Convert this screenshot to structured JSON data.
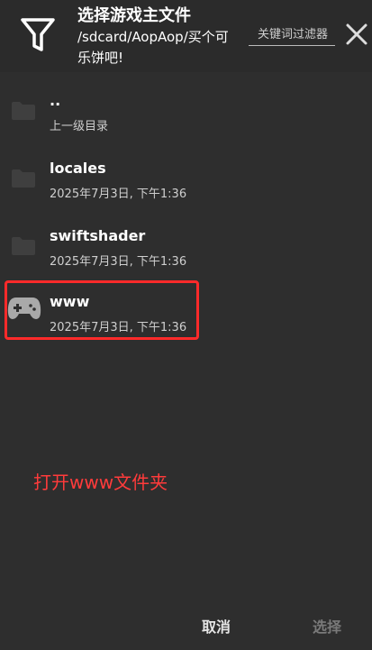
{
  "header": {
    "title": "选择游戏主文件",
    "path": "/sdcard/AopAop/买个可乐饼吧!",
    "filter_placeholder": "关键词过滤器"
  },
  "items": [
    {
      "name": "..",
      "subtitle": "上一级目录",
      "icon": "folder-icon"
    },
    {
      "name": "locales",
      "subtitle": "2025年7月3日, 下午1:36",
      "icon": "folder-icon"
    },
    {
      "name": "swiftshader",
      "subtitle": "2025年7月3日, 下午1:36",
      "icon": "folder-icon"
    },
    {
      "name": "www",
      "subtitle": "2025年7月3日, 下午1:36",
      "icon": "gamepad-icon"
    }
  ],
  "annotation": "打开www文件夹",
  "footer": {
    "cancel_label": "取消",
    "select_label": "选择"
  },
  "colors": {
    "background": "#2e2e2e",
    "highlight": "#ff2a2a",
    "annotation": "#ff3b3b",
    "disabled_text": "#7a7a7a"
  }
}
